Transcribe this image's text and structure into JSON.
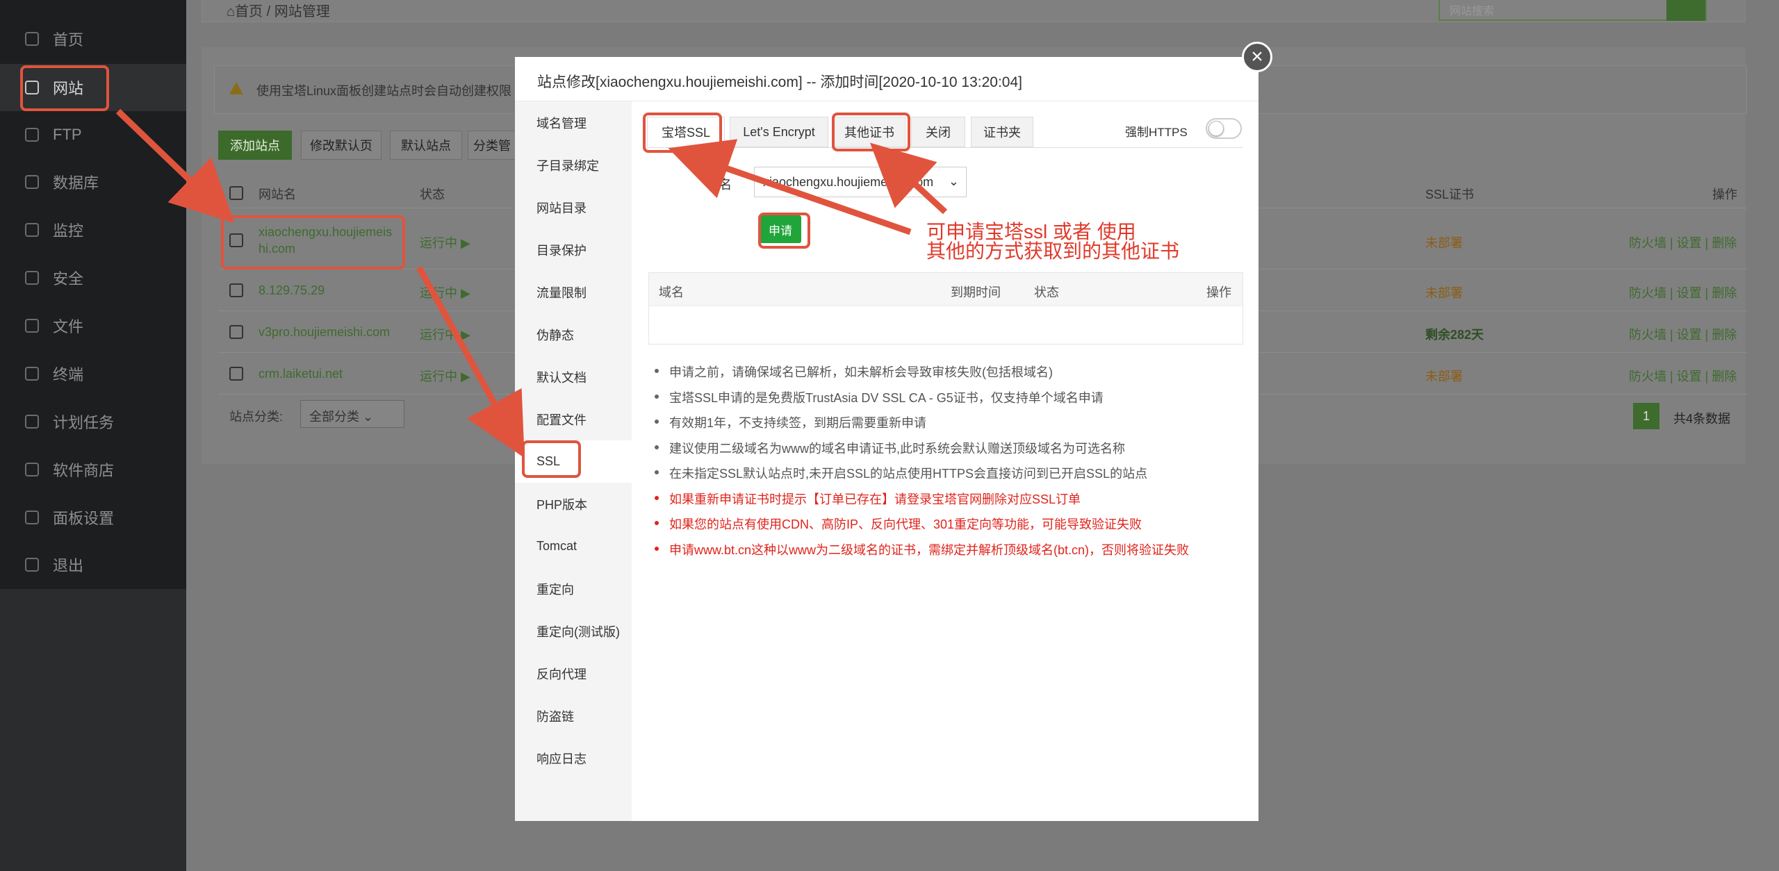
{
  "sidebar": {
    "items": [
      {
        "label": "首页",
        "icon": "home-icon"
      },
      {
        "label": "网站",
        "icon": "globe-icon"
      },
      {
        "label": "FTP",
        "icon": "ftp-icon"
      },
      {
        "label": "数据库",
        "icon": "database-icon"
      },
      {
        "label": "监控",
        "icon": "monitor-icon"
      },
      {
        "label": "安全",
        "icon": "shield-icon"
      },
      {
        "label": "文件",
        "icon": "folder-icon"
      },
      {
        "label": "终端",
        "icon": "terminal-icon"
      },
      {
        "label": "计划任务",
        "icon": "calendar-icon"
      },
      {
        "label": "软件商店",
        "icon": "grid-icon"
      },
      {
        "label": "面板设置",
        "icon": "gear-icon"
      },
      {
        "label": "退出",
        "icon": "logout-icon"
      }
    ]
  },
  "breadcrumb": {
    "home": "首页",
    "sep": "/",
    "current": "网站管理"
  },
  "search": {
    "placeholder": "网站搜索"
  },
  "tip": "使用宝塔Linux面板创建站点时会自动创建权限",
  "toolbar": {
    "add": "添加站点",
    "edit_default": "修改默认页",
    "default_site": "默认站点",
    "category": "分类管"
  },
  "table": {
    "headers": {
      "name": "网站名",
      "status": "状态",
      "ssl": "SSL证书",
      "ops": "操作"
    },
    "rows": [
      {
        "name": "xiaochengxu.houjiemeis",
        "name2": "hi.com",
        "status": "运行中 ▶",
        "ssl": "未部署",
        "ops": "防火墙 | 设置 | 删除"
      },
      {
        "name": "8.129.75.29",
        "status": "运行中 ▶",
        "ssl": "未部署",
        "ops": "防火墙 | 设置 | 删除"
      },
      {
        "name": "v3pro.houjiemeishi.com",
        "status": "运行中 ▶",
        "ssl": "剩余282天",
        "ops": "防火墙 | 设置 | 删除"
      },
      {
        "name": "crm.laiketui.net",
        "status": "运行中 ▶",
        "ssl": "未部署",
        "ops": "防火墙 | 设置 | 删除"
      }
    ]
  },
  "footer": {
    "category_label": "站点分类:",
    "category_value": "全部分类",
    "page": "1",
    "total": "共4条数据"
  },
  "modal": {
    "title": "站点修改[xiaochengxu.houjiemeishi.com] -- 添加时间[2020-10-10 13:20:04]",
    "close": "×",
    "nav": [
      "域名管理",
      "子目录绑定",
      "网站目录",
      "目录保护",
      "流量限制",
      "伪静态",
      "默认文档",
      "配置文件",
      "SSL",
      "PHP版本",
      "Tomcat",
      "重定向",
      "重定向(测试版)",
      "反向代理",
      "防盗链",
      "响应日志"
    ],
    "tabs": [
      "宝塔SSL",
      "Let's Encrypt",
      "其他证书",
      "关闭",
      "证书夹"
    ],
    "force_https": "强制HTTPS",
    "domain_label": "域名",
    "domain_value": "xiaochengxu.houjiemeishi.com",
    "apply": "申请",
    "cert_headers": {
      "domain": "域名",
      "expire": "到期时间",
      "status": "状态",
      "ops": "操作"
    },
    "notes": [
      {
        "text": "申请之前，请确保域名已解析，如未解析会导致审核失败(包括根域名)",
        "red": false
      },
      {
        "text": "宝塔SSL申请的是免费版TrustAsia DV SSL CA - G5证书，仅支持单个域名申请",
        "red": false
      },
      {
        "text": "有效期1年，不支持续签，到期后需要重新申请",
        "red": false
      },
      {
        "text": "建议使用二级域名为www的域名申请证书,此时系统会默认赠送顶级域名为可选名称",
        "red": false
      },
      {
        "text": "在未指定SSL默认站点时,未开启SSL的站点使用HTTPS会直接访问到已开启SSL的站点",
        "red": false
      },
      {
        "text": "如果重新申请证书时提示【订单已存在】请登录宝塔官网删除对应SSL订单",
        "red": true
      },
      {
        "text": "如果您的站点有使用CDN、高防IP、反向代理、301重定向等功能，可能导致验证失败",
        "red": true
      },
      {
        "text": "申请www.bt.cn这种以www为二级域名的证书，需绑定并解析顶级域名(bt.cn)，否则将验证失败",
        "red": true
      }
    ]
  },
  "annotation": {
    "line1": "可申请宝塔ssl 或者 使用",
    "line2": "其他的方式获取到的其他证书"
  },
  "colors": {
    "accent": "#20a53a",
    "annotation": "#e0392a"
  }
}
